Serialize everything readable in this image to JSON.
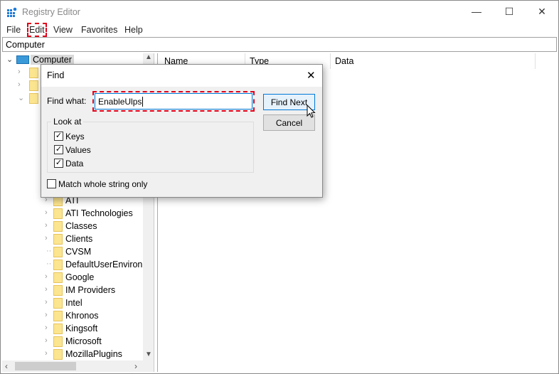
{
  "window": {
    "title": "Registry Editor",
    "minimize": "—",
    "maximize": "☐",
    "close": "✕"
  },
  "menu": [
    "File",
    "Edit",
    "View",
    "Favorites",
    "Help"
  ],
  "address": "Computer",
  "tree": {
    "root": "Computer",
    "items": [
      "ATI",
      "ATI Technologies",
      "Classes",
      "Clients",
      "CVSM",
      "DefaultUserEnvironn",
      "Google",
      "IM Providers",
      "Intel",
      "Khronos",
      "Kingsoft",
      "Microsoft",
      "MozillaPlugins"
    ]
  },
  "columns": [
    "Name",
    "Type",
    "Data"
  ],
  "dialog": {
    "title": "Find",
    "close": "✕",
    "find_what_label": "Find what:",
    "find_what_value": "EnableUlps",
    "find_next": "Find Next",
    "cancel": "Cancel",
    "look_at": "Look at",
    "keys": "Keys",
    "values": "Values",
    "data": "Data",
    "keys_checked": true,
    "values_checked": true,
    "data_checked": true,
    "match_whole": "Match whole string only",
    "match_whole_checked": false
  },
  "colors": {
    "highlight": "#e0001b",
    "accent": "#0078d7"
  }
}
